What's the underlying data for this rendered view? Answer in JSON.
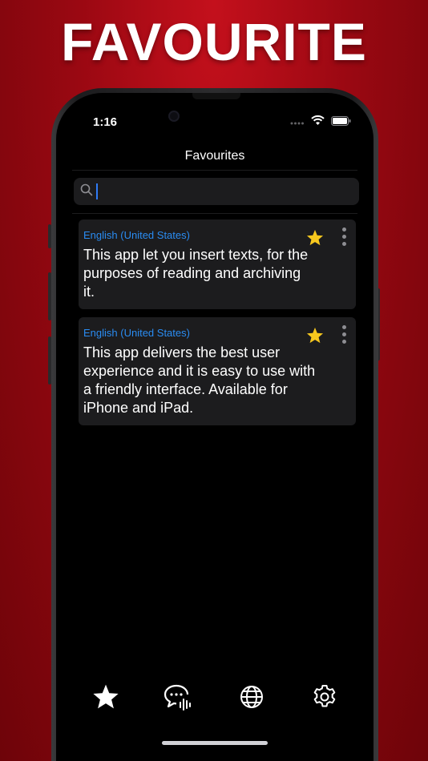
{
  "headline": "FAVOURITE",
  "status_bar": {
    "time": "1:16"
  },
  "nav": {
    "title": "Favourites"
  },
  "search": {
    "value": ""
  },
  "cards": [
    {
      "language": "English (United States)",
      "text": "This app let you insert texts, for the purposes of reading and archiving it.",
      "favourited": true
    },
    {
      "language": "English (United States)",
      "text": "This app delivers the best user experience and it is easy to use with a friendly interface. Available for iPhone and iPad.",
      "favourited": true
    }
  ],
  "tabs": [
    {
      "icon": "star-icon",
      "active": true
    },
    {
      "icon": "speech-bubble-audio-icon",
      "active": false
    },
    {
      "icon": "globe-icon",
      "active": false
    },
    {
      "icon": "gear-icon",
      "active": false
    }
  ],
  "colors": {
    "accent_blue": "#2a8cf2",
    "star_yellow": "#f7c81e",
    "background_red": "#9a0812"
  }
}
